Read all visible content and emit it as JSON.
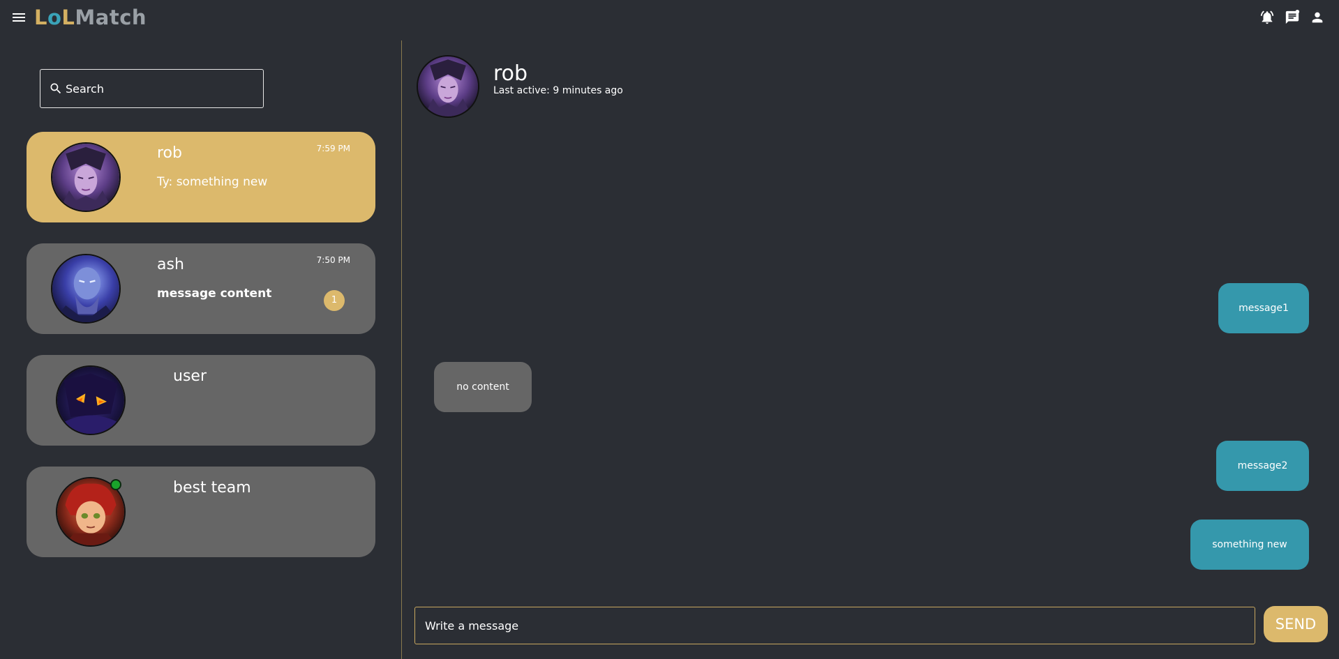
{
  "app": {
    "logo_parts": [
      "L",
      "o",
      "L",
      "Match"
    ]
  },
  "search": {
    "placeholder": "Search"
  },
  "conversations": [
    {
      "name": "rob",
      "time": "7:59 PM",
      "preview": "Ty: something new",
      "active": true,
      "unread": ""
    },
    {
      "name": "ash",
      "time": "7:50 PM",
      "preview": "message content",
      "active": false,
      "unread": "1"
    },
    {
      "name": "user",
      "time": "",
      "preview": "",
      "active": false,
      "unread": ""
    },
    {
      "name": "best team",
      "time": "",
      "preview": "",
      "active": false,
      "unread": "",
      "online": true
    }
  ],
  "chat": {
    "name": "rob",
    "status": "Last active: 9 minutes ago",
    "messages": [
      {
        "text": "message1",
        "direction": "out"
      },
      {
        "text": "no content",
        "direction": "in"
      },
      {
        "text": "message2",
        "direction": "out"
      },
      {
        "text": "something new",
        "direction": "out"
      }
    ]
  },
  "composer": {
    "placeholder": "Write a message",
    "send_label": "SEND"
  },
  "colors": {
    "background": "#2b2e34",
    "accent_gold": "#dcb96c",
    "outgoing_bubble": "#3598ac",
    "card_grey": "#666666",
    "online": "#1aa32b"
  },
  "icons": [
    "menu-icon",
    "notifications-icon",
    "messages-icon",
    "account-icon",
    "search-icon"
  ]
}
